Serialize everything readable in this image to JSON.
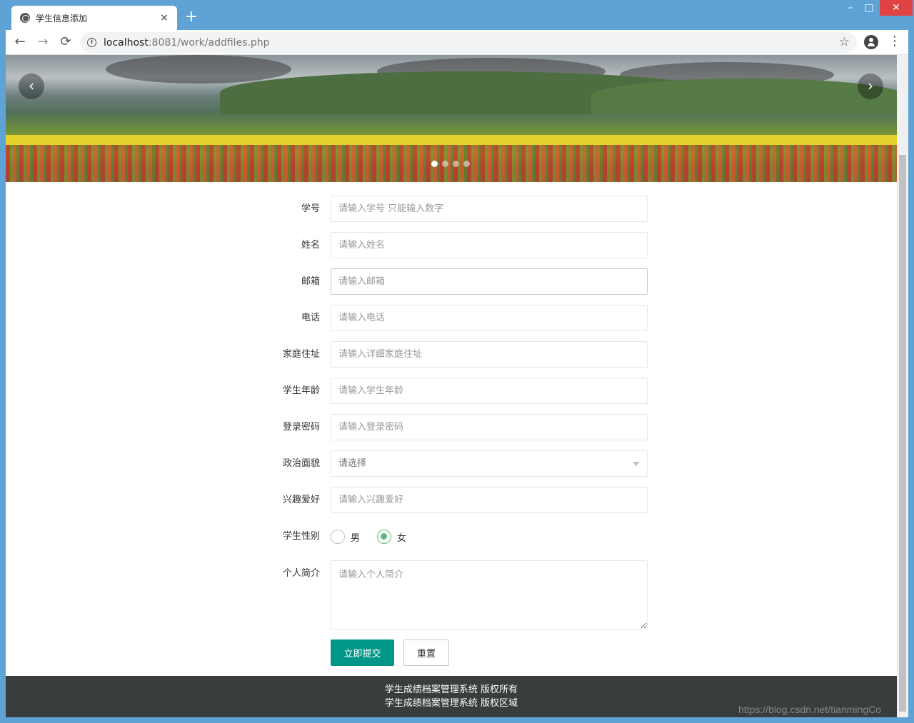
{
  "browser": {
    "tab_title": "学生信息添加",
    "tab_close": "×",
    "new_tab": "+",
    "window_min": "–",
    "window_max": "□",
    "window_close": "✕",
    "url_host": "localhost",
    "url_rest": ":8081/work/addfiles.php",
    "nav_back": "←",
    "nav_forward": "→",
    "nav_reload": "⟳",
    "bookmark_star": "☆",
    "menu": "⋮"
  },
  "carousel": {
    "prev": "‹",
    "next": "›",
    "dot_count": 4,
    "active_dot": 0
  },
  "form": {
    "student_id": {
      "label": "学号",
      "placeholder": "请输入学号 只能输入数字"
    },
    "name": {
      "label": "姓名",
      "placeholder": "请输入姓名"
    },
    "email": {
      "label": "邮箱",
      "placeholder": "请输入邮箱"
    },
    "phone": {
      "label": "电话",
      "placeholder": "请输入电话"
    },
    "address": {
      "label": "家庭住址",
      "placeholder": "请输入详细家庭住址"
    },
    "age": {
      "label": "学生年龄",
      "placeholder": "请输入学生年龄"
    },
    "password": {
      "label": "登录密码",
      "placeholder": "请输入登录密码"
    },
    "politics": {
      "label": "政治面貌",
      "selected": "请选择"
    },
    "hobby": {
      "label": "兴趣爱好",
      "placeholder": "请输入兴趣爱好"
    },
    "gender": {
      "label": "学生性别",
      "male": "男",
      "female": "女",
      "selected": "女"
    },
    "intro": {
      "label": "个人简介",
      "placeholder": "请输入个人简介"
    },
    "submit_label": "立即提交",
    "reset_label": "重置"
  },
  "footer": {
    "line1": "学生成绩档案管理系统 版权所有",
    "line2": "学生成绩档案管理系统 版权区域"
  },
  "watermark": "https://blog.csdn.net/tianmingCo",
  "colors": {
    "primary_button": "#009688",
    "radio_checked": "#5fb878",
    "footer_bg": "#393d3d",
    "window_frame": "#5fa3d6"
  }
}
